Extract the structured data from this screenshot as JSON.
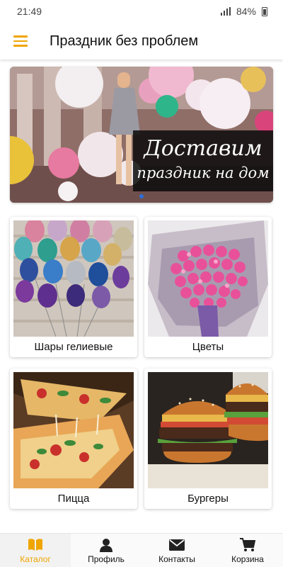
{
  "status_bar": {
    "time": "21:49",
    "battery": "84%"
  },
  "app_bar": {
    "title": "Праздник без проблем"
  },
  "banner": {
    "line1": "Доставим",
    "line2": "праздник на дом"
  },
  "categories": [
    {
      "label": "Шары гелиевые",
      "icon": "balloons-photo"
    },
    {
      "label": "Цветы",
      "icon": "flowers-photo"
    },
    {
      "label": "Пицца",
      "icon": "pizza-photo"
    },
    {
      "label": "Бургеры",
      "icon": "burgers-photo"
    }
  ],
  "bottom_nav": [
    {
      "label": "Каталог",
      "icon": "book-icon",
      "active": true
    },
    {
      "label": "Профиль",
      "icon": "person-icon"
    },
    {
      "label": "Контакты",
      "icon": "envelope-icon"
    },
    {
      "label": "Корзина",
      "icon": "cart-icon"
    }
  ],
  "colors": {
    "accent": "#f0a500",
    "indicator": "#2a6fdb"
  }
}
